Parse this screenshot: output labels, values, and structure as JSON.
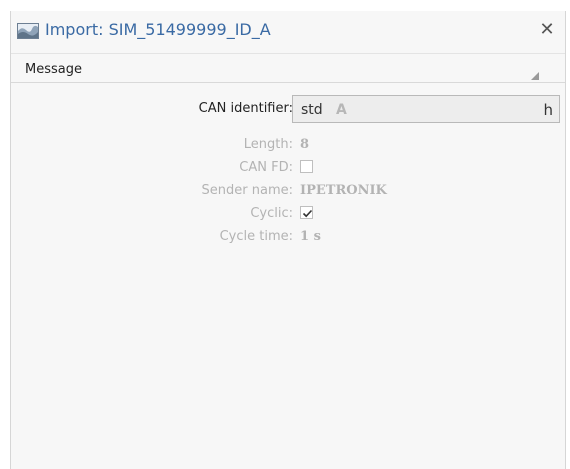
{
  "window": {
    "title": "Import: SIM_51499999_ID_A",
    "close_symbol": "✕"
  },
  "icons": {
    "title": "chart-area-icon",
    "close": "close-icon",
    "toggle": "expand-triangle-icon",
    "check": "checkmark-icon"
  },
  "section": {
    "title": "Message"
  },
  "can_identifier": {
    "label": "CAN identifier:",
    "prefix": "std",
    "value": "A",
    "suffix": "h"
  },
  "fields": {
    "length": {
      "label": "Length:",
      "value": "8"
    },
    "can_fd": {
      "label": "CAN FD:",
      "checked": false
    },
    "sender_name": {
      "label": "Sender name:",
      "value": "IPETRONIK"
    },
    "cyclic": {
      "label": "Cyclic:",
      "checked": true
    },
    "cycle_time": {
      "label": "Cycle time:",
      "value": "1 s"
    }
  },
  "colors": {
    "title_text": "#3a6aa4",
    "disabled_text": "#b3b3b3",
    "panel_bg": "#f7f7f7"
  }
}
